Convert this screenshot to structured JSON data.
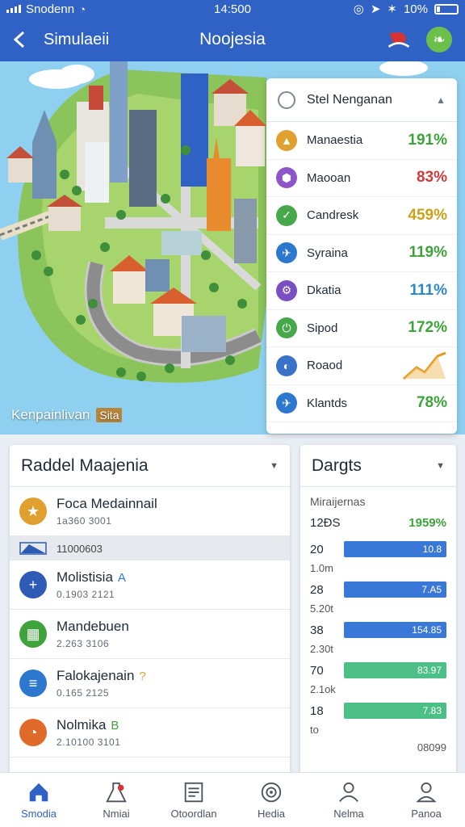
{
  "status": {
    "carrier": "Snodenn",
    "time": "14:500",
    "battery": "10%"
  },
  "header": {
    "left_label": "Simulaeii",
    "title": "Noojesia"
  },
  "map": {
    "caption": "Kenpainlivan",
    "tag": "Sita"
  },
  "panel": {
    "title": "Stel Nenganan",
    "items": [
      {
        "name": "Manaestia",
        "value": "191%",
        "color": "#3da33a",
        "icon": "triangle-icon",
        "icon_color": "#e0a030"
      },
      {
        "name": "Maooan",
        "value": "83%",
        "color": "#d33a3a",
        "icon": "hexagon-icon",
        "icon_color": "#8e55c8"
      },
      {
        "name": "Candresk",
        "value": "459%",
        "color": "#c9a21a",
        "icon": "check-icon",
        "icon_color": "#46a84a"
      },
      {
        "name": "Syraina",
        "value": "119%",
        "color": "#3da33a",
        "icon": "airplane-icon",
        "icon_color": "#2d78cf"
      },
      {
        "name": "Dkatia",
        "value": "111%",
        "color": "#2d88c8",
        "icon": "gear-icon",
        "icon_color": "#7a4fc2"
      },
      {
        "name": "Sipod",
        "value": "172%",
        "color": "#3da33a",
        "icon": "power-icon",
        "icon_color": "#46a84a"
      },
      {
        "name": "Roaod",
        "value": "",
        "color": "#3da33a",
        "icon": "globe-icon",
        "icon_color": "#3a72c8"
      },
      {
        "name": "Klantds",
        "value": "78%",
        "color": "#3da33a",
        "icon": "plane-icon",
        "icon_color": "#2d78cf"
      }
    ]
  },
  "left_card": {
    "title": "Raddel Maajenia",
    "rows": [
      {
        "name": "Foca Medainnail",
        "sub": "1a360 3001",
        "icon": "star-icon",
        "color": "#e0a030"
      },
      {
        "section": "11000603",
        "icon": "flag-icon"
      },
      {
        "name": "Molistisia",
        "mark": "A",
        "mark_color": "#2d78cf",
        "sub": "0.1903 2121",
        "icon": "plus-icon",
        "color": "#2d5bb5"
      },
      {
        "name": "Mandebuen",
        "sub": "2.263 3106",
        "icon": "building-icon",
        "color": "#3da33a"
      },
      {
        "name": "Falokajenain",
        "mark": "?",
        "mark_color": "#e0a030",
        "sub": "0.165 2125",
        "icon": "document-icon",
        "color": "#2d78cf"
      },
      {
        "name": "Nolmika",
        "mark": "B",
        "mark_color": "#3da33a",
        "sub": "2.10100 3101",
        "icon": "chart-icon",
        "color": "#e06a2a"
      }
    ]
  },
  "right_card": {
    "title": "Dargts",
    "subtitle": "Miraijernas",
    "total": "12ÐS",
    "total_pct": "1959%",
    "bars": [
      {
        "num": "20",
        "label": "10.8",
        "sub": "1.0m",
        "fill": 1.0,
        "color": "#3a78d8"
      },
      {
        "num": "28",
        "label": "7.A5",
        "sub": "5.20t",
        "fill": 1.0,
        "color": "#3a78d8"
      },
      {
        "num": "38",
        "label": "154.85",
        "sub": "2.30t",
        "fill": 1.0,
        "color": "#3a78d8"
      },
      {
        "num": "70",
        "label": "83.97",
        "sub": "2.1ok",
        "fill": 1.0,
        "color": "#4cbf86"
      },
      {
        "num": "18",
        "label": "7.83",
        "sub": "to",
        "fill": 1.0,
        "color": "#4cbf86"
      }
    ],
    "footer": "08099"
  },
  "tabs": [
    {
      "label": "Smodia",
      "icon": "home-icon",
      "active": true
    },
    {
      "label": "Nmiai",
      "icon": "flask-icon",
      "active": false
    },
    {
      "label": "Otoordlan",
      "icon": "list-icon",
      "active": false
    },
    {
      "label": "Hedia",
      "icon": "target-icon",
      "active": false
    },
    {
      "label": "Nelma",
      "icon": "user-icon",
      "active": false
    },
    {
      "label": "Panoa",
      "icon": "profile-icon",
      "active": false
    }
  ]
}
